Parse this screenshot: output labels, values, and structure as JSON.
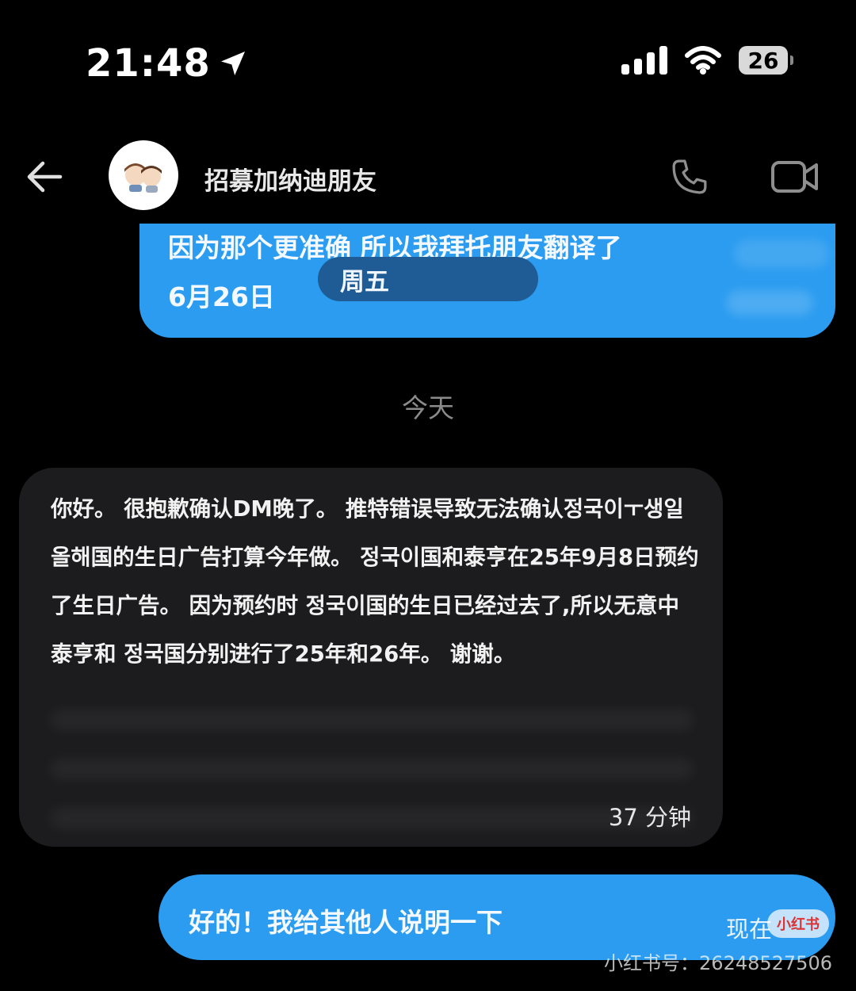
{
  "status_bar": {
    "time": "21:48",
    "battery": "26",
    "location_icon": "location-arrow-icon",
    "signal_icon": "cellular-signal-icon",
    "wifi_icon": "wifi-icon"
  },
  "header": {
    "title": "招募加纳迪朋友",
    "back_icon": "back-arrow-icon",
    "avatar_icon": "two-cartoon-kids-avatar",
    "call_icon": "phone-icon",
    "video_icon": "video-camera-icon"
  },
  "messages": {
    "sent_top": {
      "text": "因为那个更准确 所以我拜托朋友翻译了",
      "date": "6月26日",
      "day_pill": "周五"
    },
    "date_divider": "今天",
    "received": {
      "text": "你好。 很抱歉确认DM晚了。 推特错误导致无法确认정국이ㅜ생일 올해国的生日广告打算今年做。 정국이国和泰亨在25年9月8日预约了生日广告。 因为预约时 정국이国的生日已经过去了,所以无意中泰亨和 정국国分别进行了25年和26年。 谢谢。",
      "time": "37 分钟"
    },
    "sent_bottom": {
      "text": "好的！我给其他人说明一下",
      "time": "现在",
      "badge": "小红书"
    }
  },
  "watermark": "小红书号：26248527506",
  "colors": {
    "background": "#000000",
    "sent_bubble": "#2b9cf0",
    "received_bubble": "#1c1c1e",
    "divider_text": "#8b8b8b"
  }
}
